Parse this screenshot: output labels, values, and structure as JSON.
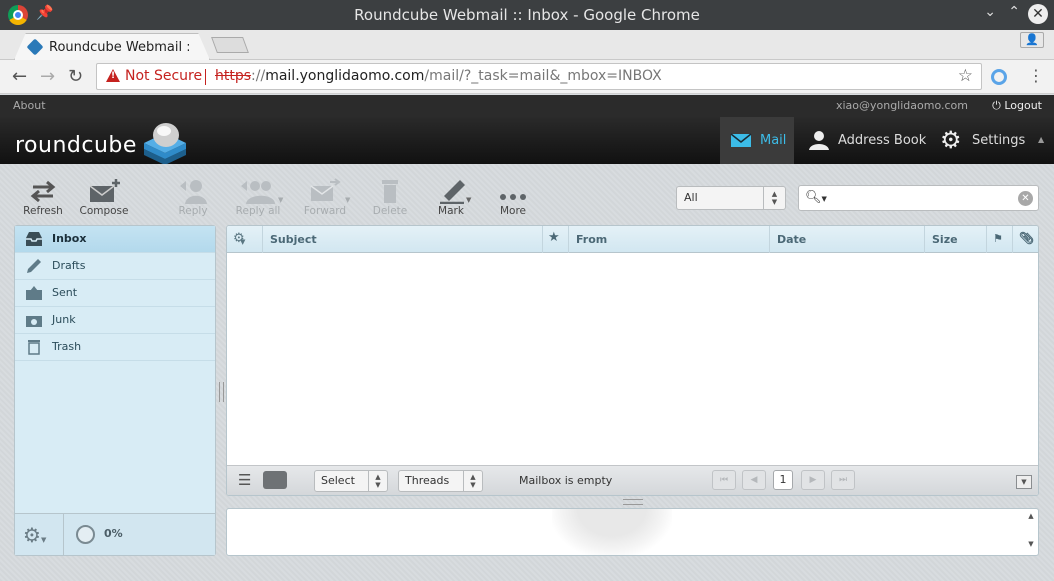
{
  "window": {
    "title": "Roundcube Webmail :: Inbox - Google Chrome"
  },
  "browser": {
    "tab_title": "Roundcube Webmail :: Inbox",
    "not_secure": "Not Secure",
    "url_proto": "https",
    "url_sep": "://",
    "url_host": "mail.yonglidaomo.com",
    "url_path": "/mail/?_task=mail&_mbox=INBOX"
  },
  "topline": {
    "about": "About",
    "user": "xiao@yonglidaomo.com",
    "logout": "Logout"
  },
  "header": {
    "logo": "roundcube",
    "tasks": [
      {
        "label": "Mail"
      },
      {
        "label": "Address Book"
      },
      {
        "label": "Settings"
      }
    ]
  },
  "toolbar": {
    "refresh": "Refresh",
    "compose": "Compose",
    "reply": "Reply",
    "reply_all": "Reply all",
    "forward": "Forward",
    "delete": "Delete",
    "mark": "Mark",
    "more": "More",
    "filter_value": "All"
  },
  "folders": [
    {
      "label": "Inbox"
    },
    {
      "label": "Drafts"
    },
    {
      "label": "Sent"
    },
    {
      "label": "Junk"
    },
    {
      "label": "Trash"
    }
  ],
  "quota": "0%",
  "list": {
    "columns": {
      "subject": "Subject",
      "from": "From",
      "date": "Date",
      "size": "Size"
    },
    "select_label": "Select",
    "threads_label": "Threads",
    "status": "Mailbox is empty",
    "page": "1"
  },
  "colors": {
    "accent": "#3cbce8",
    "folder_bg": "#d8ecf5",
    "header_bg": "#111111"
  }
}
